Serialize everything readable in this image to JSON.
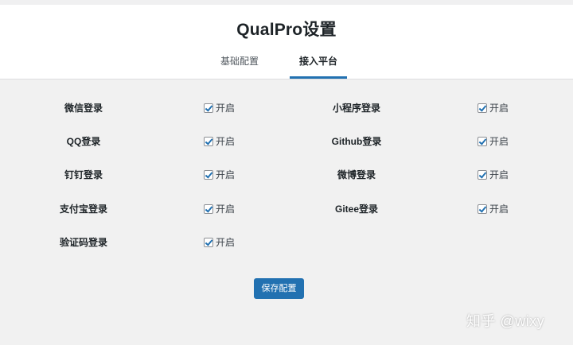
{
  "page": {
    "title": "QualPro设置"
  },
  "tabs": [
    {
      "label": "基础配置",
      "active": false
    },
    {
      "label": "接入平台",
      "active": true
    }
  ],
  "settings": {
    "toggle_label": "开启",
    "items": [
      {
        "label": "微信登录",
        "checked": true
      },
      {
        "label": "小程序登录",
        "checked": true
      },
      {
        "label": "QQ登录",
        "checked": true
      },
      {
        "label": "Github登录",
        "checked": true
      },
      {
        "label": "钉钉登录",
        "checked": true
      },
      {
        "label": "微博登录",
        "checked": true
      },
      {
        "label": "支付宝登录",
        "checked": true
      },
      {
        "label": "Gitee登录",
        "checked": true
      },
      {
        "label": "验证码登录",
        "checked": true
      }
    ]
  },
  "actions": {
    "save_label": "保存配置"
  },
  "watermark": {
    "text": "知乎 @wixy"
  },
  "colors": {
    "accent": "#2271b1",
    "background": "#f1f1f1",
    "header": "#ffffff"
  }
}
